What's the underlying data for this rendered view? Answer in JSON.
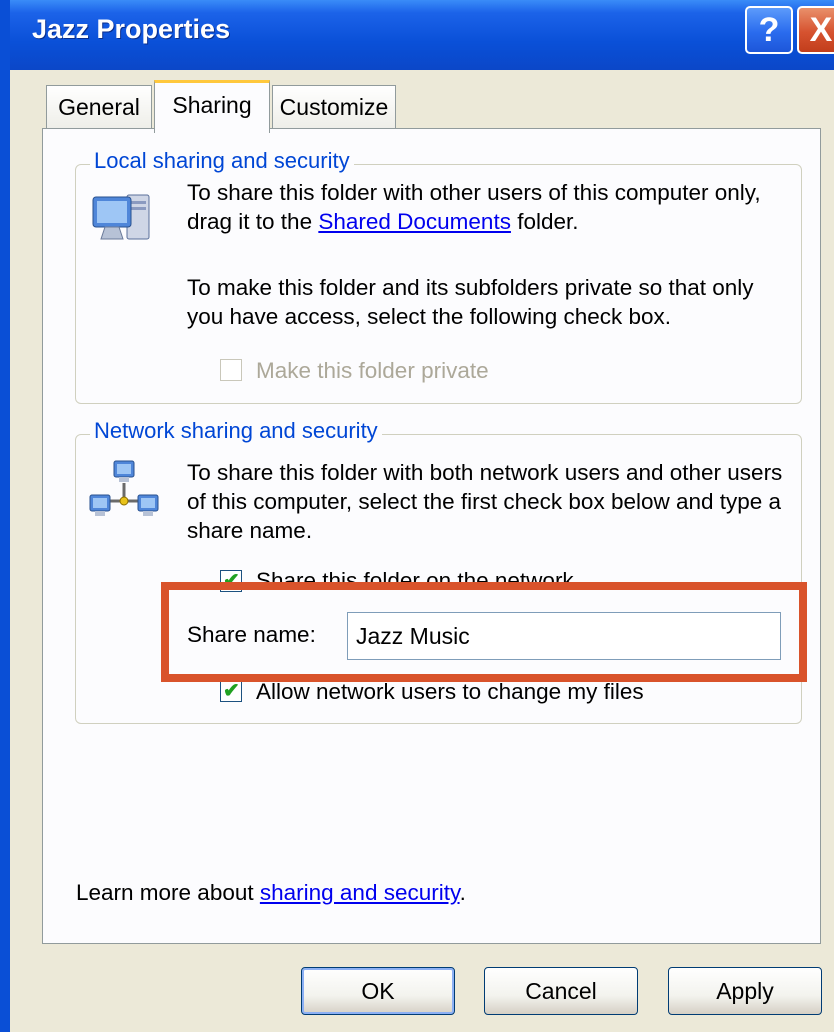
{
  "window": {
    "title": "Jazz Properties"
  },
  "title_buttons": {
    "help": "?",
    "close": "X"
  },
  "tabs": [
    {
      "label": "General"
    },
    {
      "label": "Sharing",
      "selected": true
    },
    {
      "label": "Customize"
    }
  ],
  "local": {
    "legend": "Local sharing and security",
    "text1_pre": "To share this folder with other users of this computer only, drag it to the ",
    "text1_link": "Shared Documents",
    "text1_post": " folder.",
    "text2": "To make this folder and its subfolders private so that only you have access, select the following check box.",
    "checkbox_label": "Make this folder private",
    "checkbox_checked": false,
    "checkbox_enabled": false
  },
  "network": {
    "legend": "Network sharing and security",
    "text": "To share this folder with both network users and other users of this computer, select the first check box below and type a share name.",
    "share_checkbox_label": "Share this folder on the network",
    "share_checked": true,
    "share_name_label": "Share name:",
    "share_name_value": "Jazz Music",
    "allow_checkbox_label": "Allow network users to change my files",
    "allow_checked": true
  },
  "learn": {
    "pre": "Learn more about ",
    "link": "sharing and security",
    "post": "."
  },
  "buttons": {
    "ok": "OK",
    "cancel": "Cancel",
    "apply": "Apply"
  },
  "colors": {
    "highlight": "#d9532b",
    "title_bar": "#0a50d8",
    "group_label": "#0046d5"
  },
  "icons": {
    "local": "computer-monitor-icon",
    "network": "network-computers-icon"
  }
}
